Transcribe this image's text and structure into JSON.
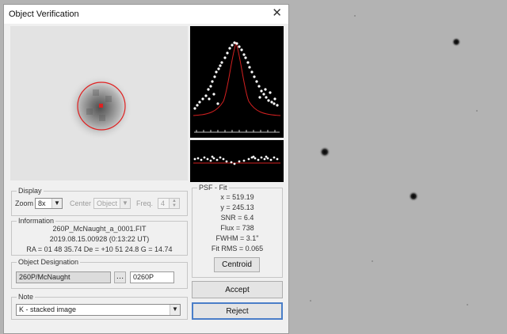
{
  "dialog": {
    "title": "Object Verification"
  },
  "display": {
    "group_label": "Display",
    "zoom_label": "Zoom",
    "zoom_value": "8x",
    "center_label": "Center",
    "center_value": "Object",
    "freq_label": "Freq.",
    "freq_value": "4"
  },
  "information": {
    "group_label": "Information",
    "filename": "260P_McNaught_a_0001.FIT",
    "datetime": "2019.08.15.00928 (0:13:22 UT)",
    "coords": "RA = 01 48 35.74   De = +10 51 24.8   G = 14.74"
  },
  "designation": {
    "group_label": "Object Designation",
    "name_value": "260P/McNaught",
    "code_value": "0260P"
  },
  "note": {
    "group_label": "Note",
    "value": "K - stacked image"
  },
  "psf": {
    "group_label": "PSF - Fit",
    "lines": [
      "x = 519.19",
      "y = 245.13",
      "SNR = 6.4",
      "Flux = 738",
      "FWHM = 3.1\"",
      "Fit RMS = 0.065"
    ],
    "centroid_label": "Centroid"
  },
  "buttons": {
    "accept_label": "Accept",
    "reject_label": "Reject"
  },
  "colors": {
    "fit_curve": "#d22020",
    "marker": "#e02020",
    "plot_bg": "#000000",
    "dialog_bg": "#f0f0f0"
  },
  "icons": {
    "close": "close-icon",
    "browse": "ellipsis-icon",
    "dropdown": "chevron-down-icon"
  }
}
